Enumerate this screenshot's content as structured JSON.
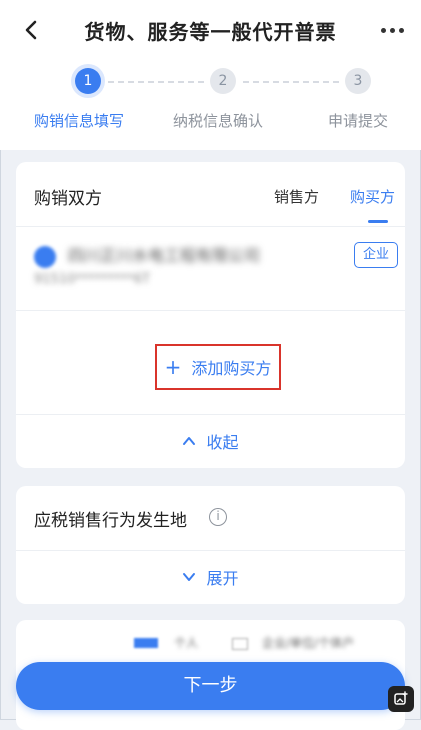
{
  "header": {
    "title": "货物、服务等一般代开普票"
  },
  "steps": [
    {
      "number": "1",
      "label": "购销信息填写",
      "state": "active"
    },
    {
      "number": "2",
      "label": "纳税信息确认",
      "state": "idle"
    },
    {
      "number": "3",
      "label": "申请提交",
      "state": "idle"
    }
  ],
  "parties": {
    "title": "购销双方",
    "tab_sellers": "销售方",
    "tab_buyers": "购买方",
    "entry": {
      "company_name": "四川正川水电工程有限公司",
      "tax_id": "91510*********6T",
      "type_badge": "企业"
    },
    "add_buyer_label": "添加购买方",
    "collapse_label": "收起"
  },
  "location": {
    "title": "应税销售行为发生地",
    "info_glyph": "i",
    "expand_label": "展开"
  },
  "peek": {
    "text_a": "个人",
    "text_b": "企业/单位/个体户"
  },
  "footer": {
    "next_label": "下一步"
  },
  "colors": {
    "accent": "#3a7df0",
    "highlight_border": "#d9342b",
    "background": "#eef1f6"
  }
}
